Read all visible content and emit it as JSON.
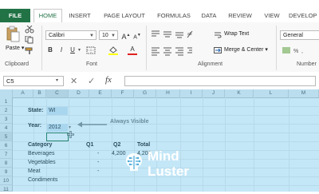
{
  "ribbon_tabs": [
    "FILE",
    "HOME",
    "INSERT",
    "PAGE LAYOUT",
    "FORMULAS",
    "DATA",
    "REVIEW",
    "VIEW",
    "DEVELOP"
  ],
  "ribbon": {
    "paste_label": "Paste",
    "clipboard_label": "Clipboard",
    "font_name": "Calibri",
    "font_size": "10",
    "font_label": "Font",
    "bold": "B",
    "italic": "I",
    "underline": "U",
    "grow_font": "A",
    "shrink_font": "A",
    "font_color_letter": "A",
    "wrap_text": "Wrap Text",
    "merge_center": "Merge & Center",
    "alignment_label": "Alignment",
    "number_format": "General",
    "number_label": "Number",
    "accent_color": "#217346"
  },
  "formula_bar": {
    "name_box": "C5",
    "fx": "fx",
    "formula": ""
  },
  "grid": {
    "columns": [
      "A",
      "B",
      "C",
      "D",
      "E",
      "F",
      "G",
      "H",
      "I",
      "J",
      "K",
      "L",
      "M"
    ],
    "rows": [
      "1",
      "2",
      "3",
      "4",
      "5",
      "6",
      "7",
      "8",
      "9",
      "10",
      "11"
    ],
    "state_label": "State:",
    "state_value": "WI",
    "year_label": "Year:",
    "year_value": "2012",
    "callout": "Always Visible",
    "headers": [
      "Category",
      "Q1",
      "Q2",
      "Total"
    ],
    "data_rows": [
      {
        "category": "Beverages",
        "q1": "-",
        "q2": "4,200",
        "total": "4,200"
      },
      {
        "category": "Vegetables",
        "q1": "-",
        "q2": "",
        "total": ""
      },
      {
        "category": "Meat",
        "q1": "-",
        "q2": "",
        "total": ""
      },
      {
        "category": "Condiments",
        "q1": "",
        "q2": "",
        "total": ""
      }
    ]
  },
  "watermark": {
    "line1": "Mind",
    "line2": "Luster"
  }
}
